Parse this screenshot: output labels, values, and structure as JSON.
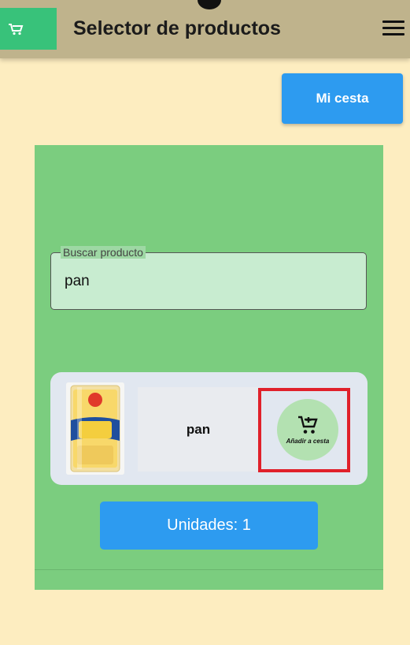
{
  "app": {
    "title": "Selector de productos",
    "logo_icon": "cart-icon",
    "menu_icon": "hamburger-menu-icon"
  },
  "header": {
    "basket_button_label": "Mi cesta"
  },
  "search": {
    "label": "Buscar producto",
    "value": "pan"
  },
  "product": {
    "name": "pan",
    "add_to_cart_label": "Añadir a cesta",
    "add_icon": "add-shopping-cart-icon"
  },
  "units_button_label": "Unidades: 1",
  "colors": {
    "background": "#fdedc0",
    "appbar": "#bfb38c",
    "panel": "#7bcd7f",
    "primary_button": "#2d9bf0",
    "highlight": "#e0202a"
  }
}
